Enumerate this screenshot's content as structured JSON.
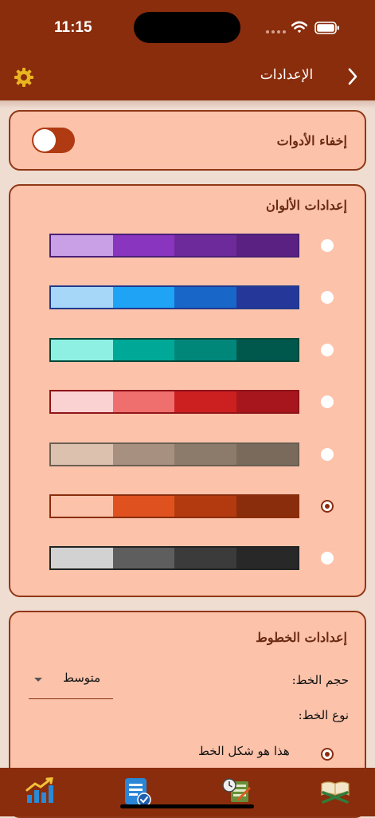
{
  "status_bar": {
    "time": "11:15"
  },
  "nav": {
    "title": "الإعدادات"
  },
  "hide_tools": {
    "label": "إخفاء الأدوات",
    "enabled": false
  },
  "colors": {
    "title": "إعدادات الألوان",
    "selected_index": 5,
    "palettes": [
      {
        "name": "purple",
        "border": "#4a2077",
        "shades": [
          "#c9a0e6",
          "#8a35bf",
          "#6c2a9a",
          "#5a2082"
        ]
      },
      {
        "name": "blue",
        "border": "#223a8c",
        "shades": [
          "#a6d6f8",
          "#1fa3f5",
          "#1866c8",
          "#26379a"
        ]
      },
      {
        "name": "teal",
        "border": "#00473a",
        "shades": [
          "#8ef0e2",
          "#00a897",
          "#00877a",
          "#00584c"
        ]
      },
      {
        "name": "red",
        "border": "#8e1419",
        "shades": [
          "#fbd2d2",
          "#ef6f6f",
          "#cc1f20",
          "#a6161c"
        ]
      },
      {
        "name": "taupe",
        "border": "#6a5f52",
        "shades": [
          "#dcc1ae",
          "#a79080",
          "#8c7a6b",
          "#7a6a5c"
        ]
      },
      {
        "name": "orange",
        "border": "#8a2d0c",
        "shades": [
          "#fdc3aa",
          "#e05120",
          "#b3390f",
          "#8a2d0c"
        ]
      },
      {
        "name": "gray",
        "border": "#222222",
        "shades": [
          "#d2d2d2",
          "#5e5e5e",
          "#3b3b3b",
          "#282828"
        ]
      }
    ]
  },
  "fonts": {
    "title": "إعدادات الخطوط",
    "size_label": "حجم الخط:",
    "size_value": "متوسط",
    "type_label": "نوع الخط:",
    "sample_text": "هذا هو شكل الخط"
  },
  "theme": {
    "primary": "#8a2d0c",
    "card_bg": "#fdc3aa",
    "page_bg": "#f0ddd2"
  },
  "tabbar": {
    "tabs": [
      {
        "name": "quran",
        "icon": "quran-book-icon"
      },
      {
        "name": "tasks",
        "icon": "clock-checklist-icon"
      },
      {
        "name": "notes",
        "icon": "note-check-icon"
      },
      {
        "name": "stats",
        "icon": "stats-chart-icon"
      }
    ]
  }
}
